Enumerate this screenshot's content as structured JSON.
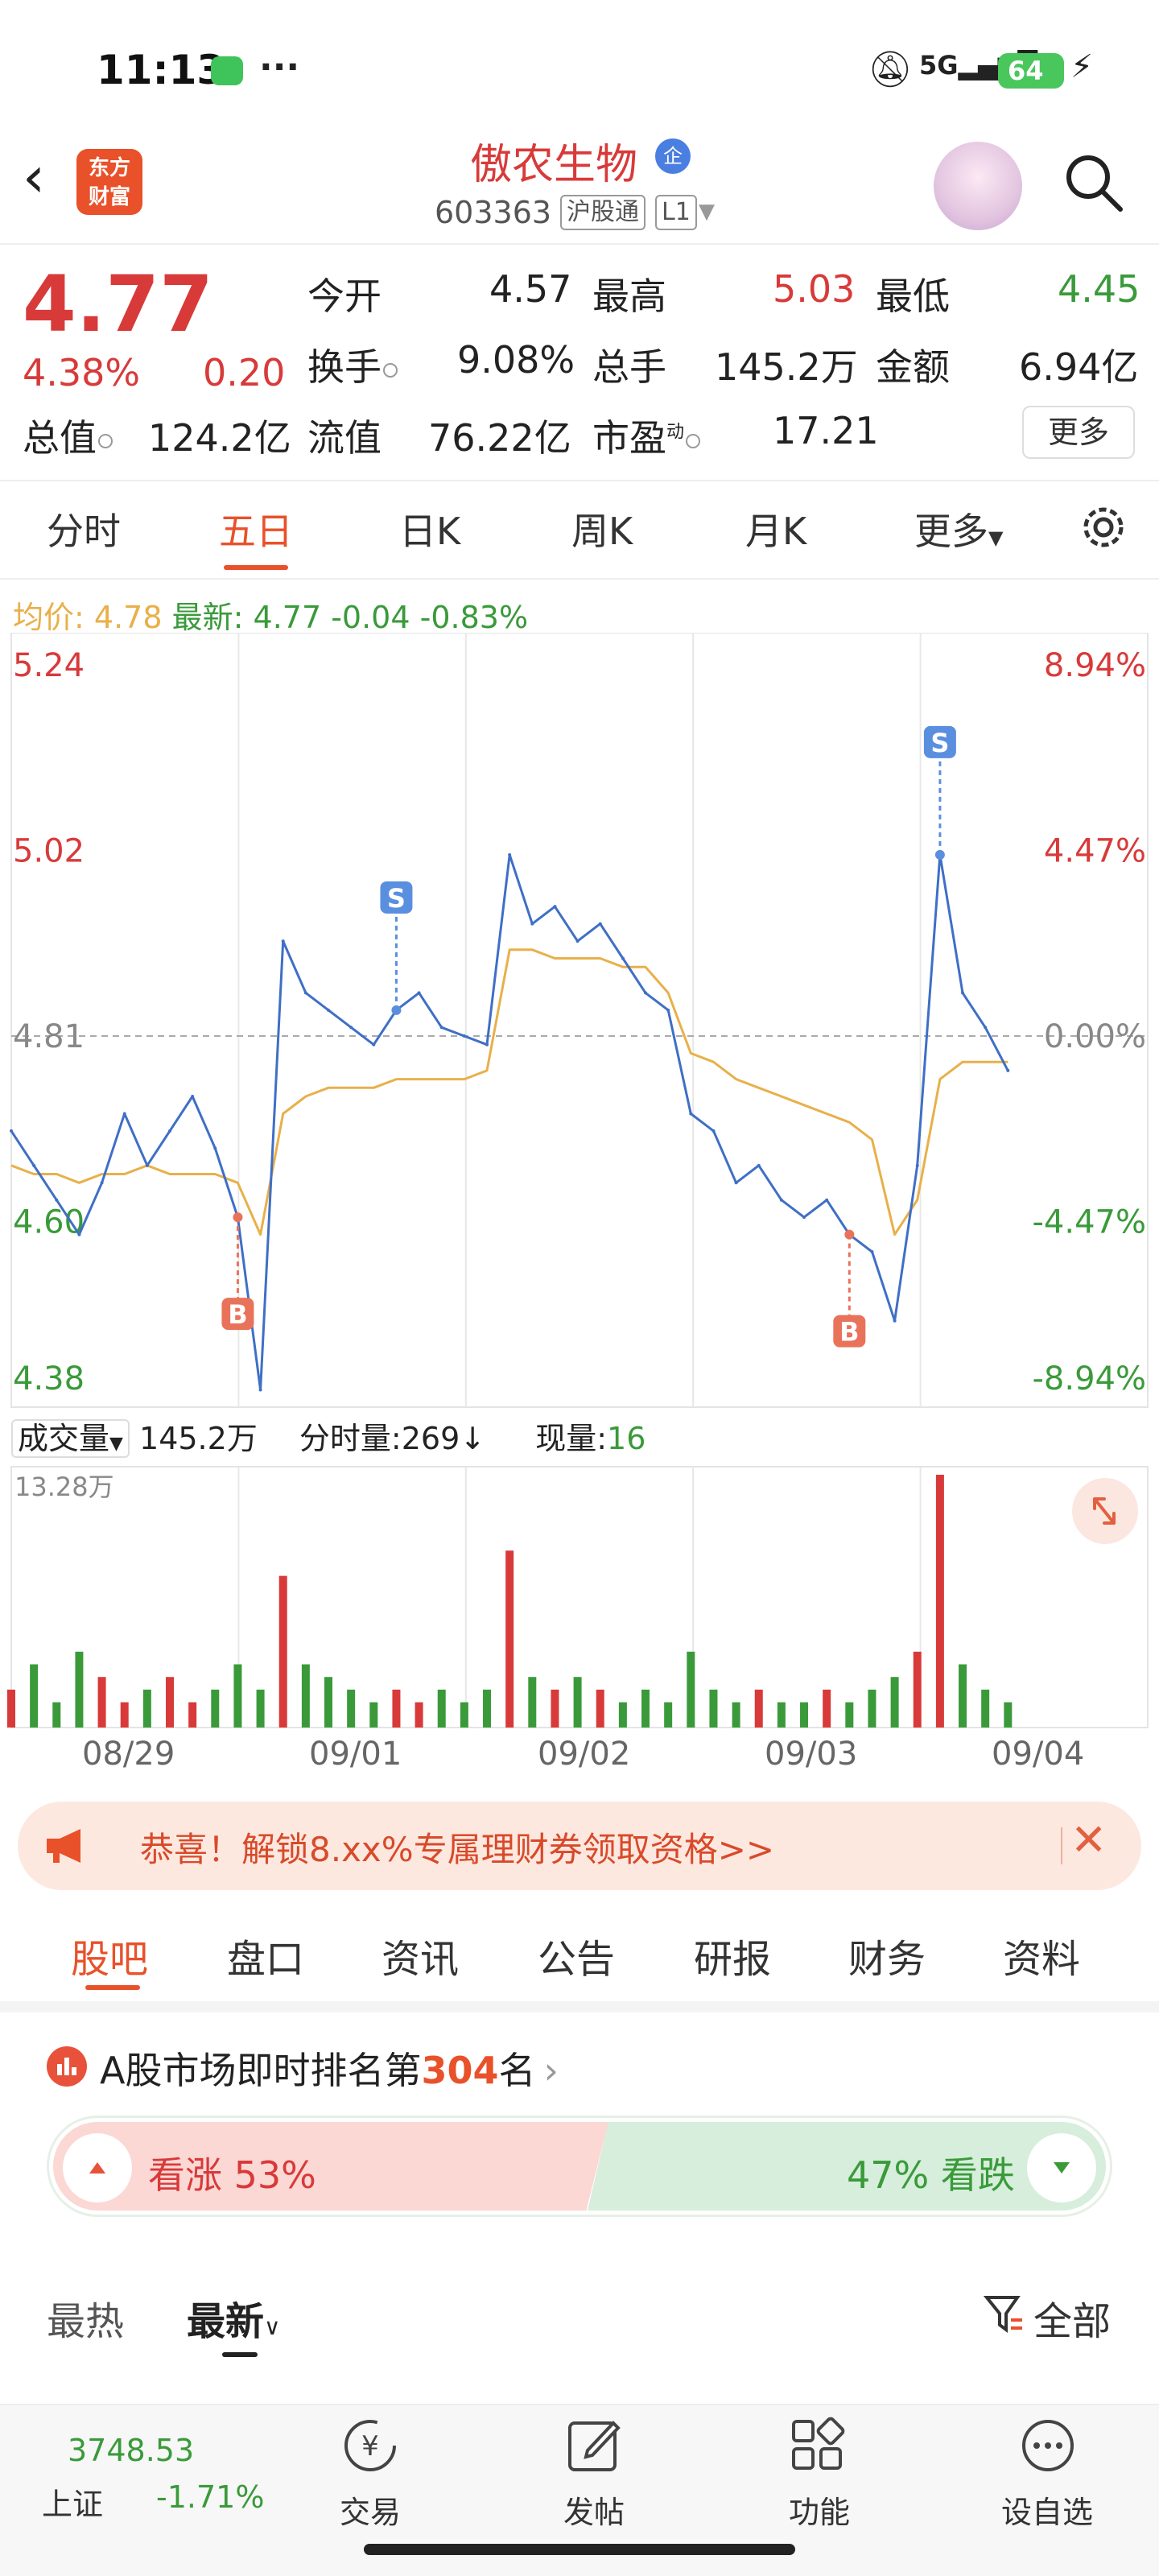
{
  "status_bar": {
    "time": "11:13",
    "network": "5G",
    "battery": "64"
  },
  "header": {
    "logo_text": "东方财富",
    "stock_name": "傲农生物",
    "enterprise_badge": "企",
    "stock_code": "603363",
    "connect_tag": "沪股通",
    "level_tag": "L1"
  },
  "quote": {
    "price": "4.77",
    "change_pct": "4.38%",
    "change_amt": "0.20",
    "fields": [
      {
        "label": "今开",
        "value": "4.57"
      },
      {
        "label": "最高",
        "value": "5.03"
      },
      {
        "label": "最低",
        "value": "4.45"
      },
      {
        "label": "换手",
        "value": "9.08%"
      },
      {
        "label": "总手",
        "value": "145.2万"
      },
      {
        "label": "金额",
        "value": "6.94亿"
      },
      {
        "label": "总值",
        "value": "124.2亿"
      },
      {
        "label": "流值",
        "value": "76.22亿"
      },
      {
        "label": "市盈",
        "value": "17.21"
      }
    ],
    "pe_superscript": "动",
    "more_button": "更多"
  },
  "chart_tabs": [
    "分时",
    "五日",
    "日K",
    "周K",
    "月K",
    "更多"
  ],
  "avg_line": {
    "avg_label": "均价:",
    "avg_value": "4.78",
    "latest_label": "最新:",
    "latest_value": "4.77",
    "change": "-0.04",
    "change_pct": "-0.83%"
  },
  "chart_data": {
    "type": "line",
    "title": "",
    "y_left_ticks": [
      "5.24",
      "5.02",
      "4.81",
      "4.60",
      "4.38"
    ],
    "y_right_ticks": [
      "8.94%",
      "4.47%",
      "0.00%",
      "-4.47%",
      "-8.94%"
    ],
    "ylim": [
      4.38,
      5.24
    ],
    "x_dates": [
      "08/29",
      "09/01",
      "09/02",
      "09/03",
      "09/04"
    ],
    "series": [
      {
        "values": [
          4.7,
          4.66,
          4.62,
          4.58,
          4.64,
          4.72,
          4.66,
          4.7,
          4.74,
          4.68,
          4.6,
          4.4,
          4.92,
          4.86,
          4.84,
          4.82,
          4.8,
          4.84,
          4.86,
          4.82,
          4.81,
          4.8,
          5.02,
          4.94,
          4.96,
          4.92,
          4.94,
          4.9,
          4.86,
          4.84,
          4.72,
          4.7,
          4.64,
          4.66,
          4.62,
          4.6,
          4.62,
          4.58,
          4.56,
          4.48,
          4.66,
          5.02,
          4.86,
          4.82,
          4.77
        ]
      },
      {
        "name": "均价",
        "values": [
          4.66,
          4.65,
          4.65,
          4.64,
          4.65,
          4.65,
          4.66,
          4.65,
          4.65,
          4.65,
          4.64,
          4.58,
          4.72,
          4.74,
          4.75,
          4.75,
          4.75,
          4.76,
          4.76,
          4.76,
          4.76,
          4.77,
          4.91,
          4.91,
          4.9,
          4.9,
          4.9,
          4.89,
          4.89,
          4.86,
          4.79,
          4.78,
          4.76,
          4.75,
          4.74,
          4.73,
          4.72,
          4.71,
          4.69,
          4.58,
          4.62,
          4.76,
          4.78,
          4.78,
          4.78
        ]
      }
    ],
    "markers": [
      {
        "label": "B",
        "point": 10
      },
      {
        "label": "S",
        "point": 17
      },
      {
        "label": "B",
        "point": 37
      },
      {
        "label": "S",
        "point": 41
      }
    ],
    "volume": {
      "label": "成交量",
      "total": "145.2万",
      "tick_label": "分时量:269",
      "current_label": "现量:",
      "current_value": "16",
      "max_tick": "13.28万",
      "values": [
        3,
        5,
        2,
        6,
        4,
        2,
        3,
        4,
        2,
        3,
        5,
        3,
        12,
        5,
        4,
        3,
        2,
        3,
        2,
        3,
        2,
        3,
        14,
        4,
        3,
        4,
        3,
        2,
        3,
        2,
        6,
        3,
        2,
        3,
        2,
        2,
        3,
        2,
        3,
        4,
        6,
        20,
        5,
        3,
        2
      ]
    },
    "colors": {
      "price": "#3f6fc6",
      "avg": "#e8b04a",
      "up": "#d83a3a",
      "down": "#3a9a3a"
    }
  },
  "banner": {
    "text": "恭喜！解锁8.xx%专属理财券领取资格>>"
  },
  "lower_tabs": [
    "股吧",
    "盘口",
    "资讯",
    "公告",
    "研报",
    "财务",
    "资料"
  ],
  "rank": {
    "prefix": "A股市场即时排名第",
    "number": "304",
    "suffix": "名"
  },
  "sentiment": {
    "up_label": "看涨 53%",
    "down_label": "47% 看跌",
    "up_fraction": 0.53
  },
  "filters": {
    "hot": "最热",
    "new": "最新",
    "all": "全部"
  },
  "bottom_nav": {
    "index_value": "3748.53",
    "index_name": "上证",
    "index_change": "-1.71%",
    "items": [
      "交易",
      "发帖",
      "功能",
      "设自选"
    ]
  }
}
